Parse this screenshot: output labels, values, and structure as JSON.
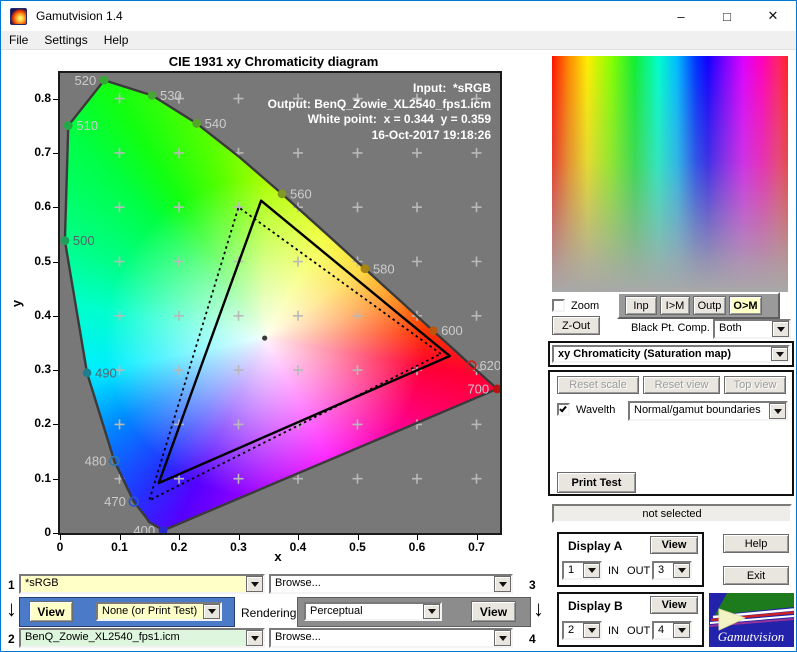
{
  "window": {
    "title": "Gamutvision 1.4",
    "controls": {
      "minimize": "–",
      "maximize": "□",
      "close": "✕"
    }
  },
  "menu": {
    "items": [
      {
        "label": "File"
      },
      {
        "label": "Settings"
      },
      {
        "label": "Help"
      }
    ]
  },
  "chart_data": {
    "type": "chromaticity-diagram",
    "title": "CIE 1931 xy Chromaticity diagram",
    "xlabel": "x",
    "ylabel": "y",
    "xlim": [
      0,
      0.75
    ],
    "ylim": [
      0,
      0.85
    ],
    "xticks": [
      0,
      0.1,
      0.2,
      0.3,
      0.4,
      0.5,
      0.6,
      0.7
    ],
    "yticks": [
      0,
      0.1,
      0.2,
      0.3,
      0.4,
      0.5,
      0.6,
      0.7,
      0.8
    ],
    "grid_step": 0.1,
    "grid": true,
    "annotations": [
      "Input:  *sRGB",
      "Output: BenQ_Zowie_XL2540_fps1.icm",
      "White point:  x = 0.344  y = 0.359",
      "16-Oct-2017 19:18:26"
    ],
    "white_point": {
      "x": 0.344,
      "y": 0.359
    },
    "spectral_locus": [
      [
        0.1741,
        0.005
      ],
      [
        0.15,
        0.02
      ],
      [
        0.144,
        0.0297
      ],
      [
        0.1241,
        0.0578
      ],
      [
        0.0913,
        0.1327
      ],
      [
        0.0454,
        0.295
      ],
      [
        0.0082,
        0.5384
      ],
      [
        0.0139,
        0.7502
      ],
      [
        0.0743,
        0.8338
      ],
      [
        0.1547,
        0.8059
      ],
      [
        0.2296,
        0.7543
      ],
      [
        0.3016,
        0.6923
      ],
      [
        0.3731,
        0.6245
      ],
      [
        0.4441,
        0.5547
      ],
      [
        0.5125,
        0.4866
      ],
      [
        0.5752,
        0.4242
      ],
      [
        0.627,
        0.3725
      ],
      [
        0.6658,
        0.334
      ],
      [
        0.6915,
        0.3083
      ],
      [
        0.7347,
        0.2653
      ]
    ],
    "wavelength_markers": [
      {
        "nm": "400",
        "x": 0.1733,
        "y": 0.0048,
        "color": "#2a2ad0",
        "filled": true,
        "label_side": "left",
        "label_color": "#cccccc"
      },
      {
        "nm": "470",
        "x": 0.1241,
        "y": 0.0578,
        "color": "#2a55cc",
        "filled": false,
        "label_side": "left",
        "label_color": "#cccccc"
      },
      {
        "nm": "480",
        "x": 0.0913,
        "y": 0.1327,
        "color": "#3377aa",
        "filled": false,
        "label_side": "left",
        "label_color": "#cccccc"
      },
      {
        "nm": "490",
        "x": 0.0454,
        "y": 0.295,
        "color": "#1e7f90",
        "filled": true,
        "label_side": "right",
        "label_color": "#55606a"
      },
      {
        "nm": "500",
        "x": 0.0082,
        "y": 0.5384,
        "color": "#1fa05a",
        "filled": true,
        "label_side": "right",
        "label_color": "#55606a"
      },
      {
        "nm": "510",
        "x": 0.0139,
        "y": 0.7502,
        "color": "#22aa44",
        "filled": true,
        "label_side": "right",
        "label_color": "#cccccc"
      },
      {
        "nm": "520",
        "x": 0.0743,
        "y": 0.8338,
        "color": "#33aa33",
        "filled": true,
        "label_side": "left",
        "label_color": "#cccccc"
      },
      {
        "nm": "530",
        "x": 0.1547,
        "y": 0.8059,
        "color": "#44a832",
        "filled": true,
        "label_side": "right",
        "label_color": "#cccccc"
      },
      {
        "nm": "540",
        "x": 0.2296,
        "y": 0.7543,
        "color": "#55a52b",
        "filled": true,
        "label_side": "right",
        "label_color": "#cccccc"
      },
      {
        "nm": "560",
        "x": 0.3731,
        "y": 0.6245,
        "color": "#7f9a20",
        "filled": true,
        "label_side": "right",
        "label_color": "#cccccc"
      },
      {
        "nm": "580",
        "x": 0.5125,
        "y": 0.4866,
        "color": "#a88414",
        "filled": true,
        "label_side": "right",
        "label_color": "#cccccc"
      },
      {
        "nm": "600",
        "x": 0.627,
        "y": 0.3725,
        "color": "#bb5510",
        "filled": true,
        "label_side": "right",
        "label_color": "#cccccc"
      },
      {
        "nm": "620",
        "x": 0.6915,
        "y": 0.3083,
        "color": "#cc2222",
        "filled": false,
        "label_side": "right",
        "label_color": "#cccccc"
      },
      {
        "nm": "700",
        "x": 0.7347,
        "y": 0.2653,
        "color": "#bb1111",
        "filled": true,
        "label_side": "left",
        "label_color": "#cccccc"
      }
    ],
    "gamuts": [
      {
        "name": "input-srgb",
        "style": "dotted",
        "points": [
          [
            0.64,
            0.33
          ],
          [
            0.3,
            0.6
          ],
          [
            0.15,
            0.06
          ]
        ]
      },
      {
        "name": "output-monitor",
        "style": "solid",
        "points": [
          [
            0.655,
            0.326
          ],
          [
            0.338,
            0.612
          ],
          [
            0.166,
            0.092
          ]
        ]
      }
    ]
  },
  "right_panel": {
    "zoom_checkbox": {
      "label": "Zoom",
      "checked": false
    },
    "gamut_buttons": [
      {
        "label": "Inp"
      },
      {
        "label": "I>M"
      },
      {
        "label": "Outp"
      },
      {
        "label": "O>M"
      }
    ],
    "zout_button": "Z-Out",
    "black_pt": {
      "label": "Black Pt. Comp.",
      "value": "Both"
    },
    "view_mode_select": "xy Chromaticity (Saturation map)",
    "reset_scale": "Reset scale",
    "reset_view": "Reset view",
    "top_view": "Top view",
    "wavelth_checkbox": {
      "label": "Wavelth",
      "checked": true
    },
    "boundaries_select": "Normal/gamut boundaries",
    "print_test": "Print Test",
    "status": "not selected",
    "display_a": {
      "title": "Display A",
      "view": "View",
      "in": "1",
      "inout": "IN OUT",
      "out": "3"
    },
    "display_b": {
      "title": "Display B",
      "view": "View",
      "in": "2",
      "inout": "IN OUT",
      "out": "4"
    },
    "help": "Help",
    "exit": "Exit",
    "logo_text": "Gamutvision"
  },
  "bottom": {
    "slot1": {
      "num": "1",
      "value": "*sRGB"
    },
    "slot2": {
      "num": "2",
      "value": "BenQ_Zowie_XL2540_fps1.icm"
    },
    "slot3": {
      "num": "3",
      "value": "Browse..."
    },
    "slot4": {
      "num": "4",
      "value": "Browse..."
    },
    "view_left": "View",
    "view_right": "View",
    "none_select": "None (or Print Test)",
    "rendering_label": "Rendering",
    "rendering_select": "Perceptual",
    "arrow": "↓"
  }
}
